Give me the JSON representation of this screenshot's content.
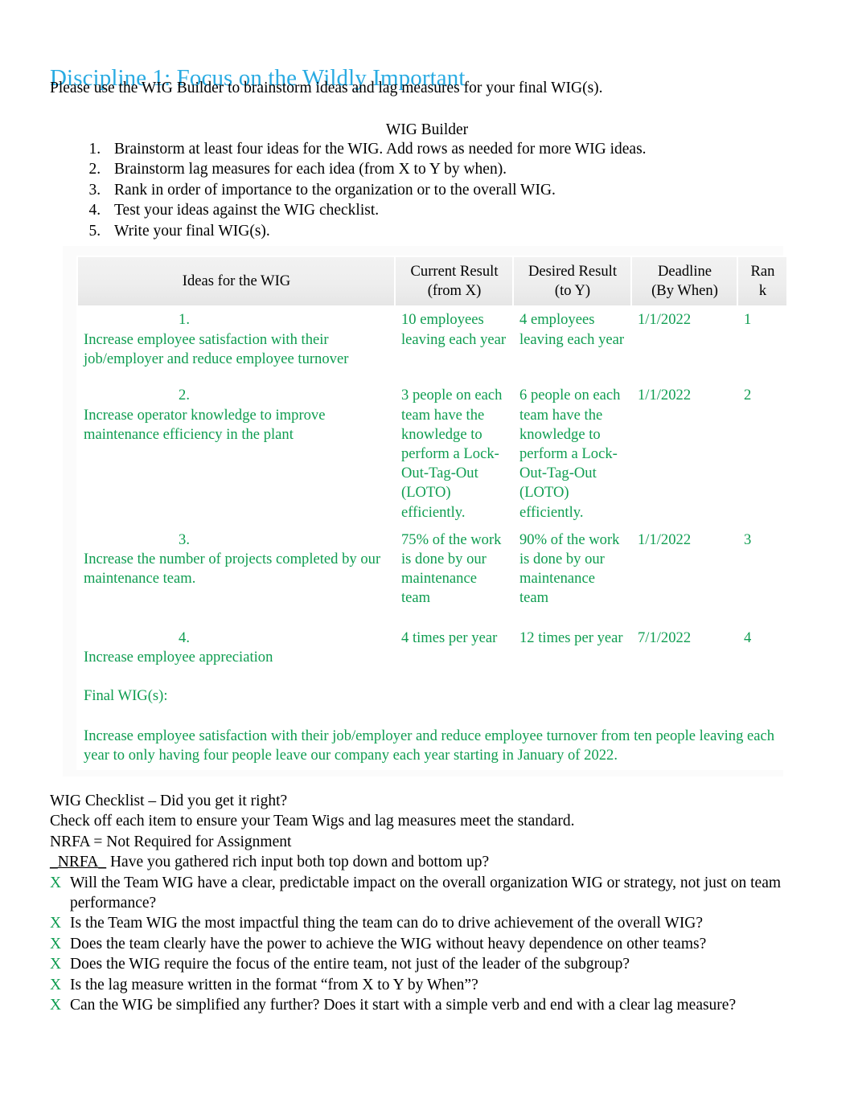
{
  "heading": {
    "title": "Discipline 1: Focus on the Wildly Important",
    "intro": "Please use the WIG Builder to brainstorm ideas and lag measures for your final WIG(s)."
  },
  "builder": {
    "title": "WIG Builder",
    "steps": [
      "Brainstorm at least four ideas for the WIG. Add rows as needed for more WIG ideas.",
      "Brainstorm lag measures for each idea (from X to Y by when).",
      "Rank in order of importance to the organization or to the overall WIG.",
      "Test your ideas against the WIG checklist.",
      "Write your final WIG(s)."
    ]
  },
  "table": {
    "headers": {
      "ideas": "Ideas for the WIG",
      "current_line1": "Current Result",
      "current_line2": "(from X)",
      "desired_line1": "Desired Result",
      "desired_line2": "(to Y)",
      "deadline_line1": "Deadline",
      "deadline_line2": "(By When)",
      "rank_line1": "Ran",
      "rank_line2": "k"
    },
    "rows": [
      {
        "number": "1.",
        "idea": "Increase employee satisfaction with their job/employer and reduce employee turnover",
        "current": "10 employees leaving each year",
        "desired": "4 employees leaving each year",
        "deadline": "1/1/2022",
        "rank": "1"
      },
      {
        "number": "2.",
        "idea": "Increase operator knowledge to improve maintenance efficiency in the plant",
        "current": "3 people on each team have the knowledge to perform a Lock-Out-Tag-Out (LOTO) efficiently.",
        "desired": "6 people on each team have the knowledge to perform a Lock-Out-Tag-Out (LOTO) efficiently.",
        "deadline": "1/1/2022",
        "rank": "2"
      },
      {
        "number": "3.",
        "idea": "Increase the number of projects completed by our maintenance team.",
        "current": "75% of the work is done by our maintenance team",
        "desired": "90% of the work is done by our maintenance team",
        "deadline": "1/1/2022",
        "rank": "3"
      },
      {
        "number": "4.",
        "idea": "Increase employee appreciation",
        "current": "4 times per year",
        "desired": "12 times per year",
        "deadline": "7/1/2022",
        "rank": "4"
      }
    ],
    "final": {
      "label": "Final WIG(s):",
      "text": "Increase employee satisfaction with their job/employer and reduce employee turnover from ten people leaving each year to only having four people leave our company each year starting in January of 2022."
    }
  },
  "checklist": {
    "title": "WIG Checklist – Did you get it right?",
    "subtitle": "Check off each item to ensure your Team Wigs and lag measures meet the standard.",
    "legend": "NRFA = Not Required for Assignment",
    "nrfa_tag": "_NRFA_",
    "nrfa_question": "Have you gathered rich input both top down and bottom up?",
    "mark": "X",
    "items": [
      "Will the Team WIG have a clear, predictable impact on the overall organization WIG or strategy, not just on team performance?",
      "Is the Team WIG the most impactful thing the team can do to drive achievement of the overall WIG?",
      "Does the team clearly have the power to achieve the WIG without heavy dependence on other teams?",
      "Does the WIG require the focus of the entire team, not just of the leader of the subgroup?",
      "Is the lag measure written in the format “from X to Y by When”?",
      "Can the WIG be simplified any further? Does it start with a simple verb and end with a clear lag measure?"
    ]
  },
  "colors": {
    "title_blue": "#29abe2",
    "entry_green": "#0f9d51",
    "body_black": "#000000"
  }
}
